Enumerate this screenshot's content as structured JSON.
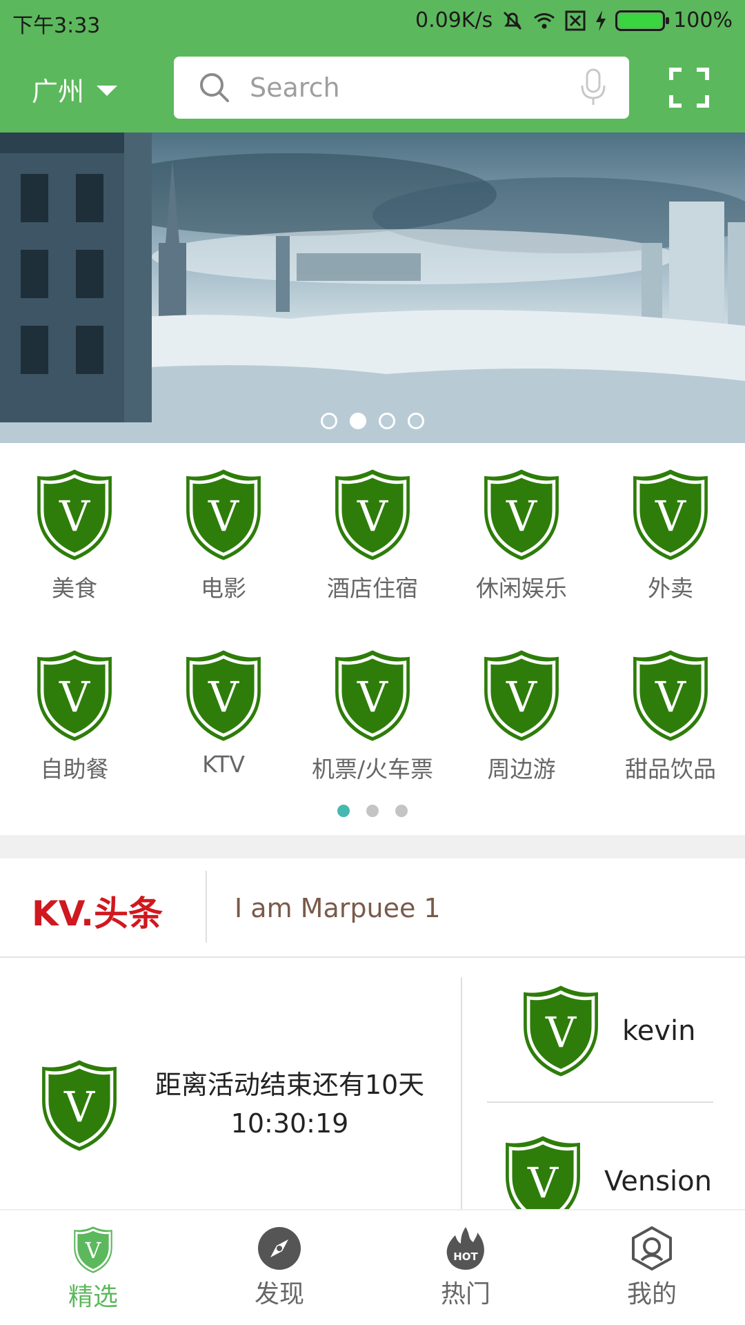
{
  "status": {
    "time": "下午3:33",
    "speed": "0.09K/s",
    "battery": "100%"
  },
  "header": {
    "city": "广州",
    "search_placeholder": "Search"
  },
  "banner": {
    "pages": 4,
    "active_page": 2
  },
  "categories": [
    {
      "label": "美食",
      "icon": "shield-v-icon"
    },
    {
      "label": "电影",
      "icon": "shield-v-icon"
    },
    {
      "label": "酒店住宿",
      "icon": "shield-v-icon"
    },
    {
      "label": "休闲娱乐",
      "icon": "shield-v-icon"
    },
    {
      "label": "外卖",
      "icon": "shield-v-icon"
    },
    {
      "label": "自助餐",
      "icon": "shield-v-icon"
    },
    {
      "label": "KTV",
      "icon": "shield-v-icon"
    },
    {
      "label": "机票/火车票",
      "icon": "shield-v-icon"
    },
    {
      "label": "周边游",
      "icon": "shield-v-icon"
    },
    {
      "label": "甜品饮品",
      "icon": "shield-v-icon"
    }
  ],
  "category_pager": {
    "pages": 3,
    "active_page": 1
  },
  "headline": {
    "brand": "KV.头条",
    "text": "I am Marpuee 1"
  },
  "promo": {
    "line1": "距离活动结束还有10天",
    "line2": "10:30:19",
    "users": [
      "kevin",
      "Vension"
    ]
  },
  "tabs": [
    {
      "label": "精选",
      "icon": "shield-v-icon"
    },
    {
      "label": "发现",
      "icon": "compass-icon"
    },
    {
      "label": "热门",
      "icon": "hot-flame-icon"
    },
    {
      "label": "我的",
      "icon": "profile-hex-icon"
    }
  ],
  "colors": {
    "brand_green": "#5cb85c",
    "shield_green": "#2e7d0a",
    "headline_red": "#d0181f",
    "pager_active": "#45b9b0"
  }
}
